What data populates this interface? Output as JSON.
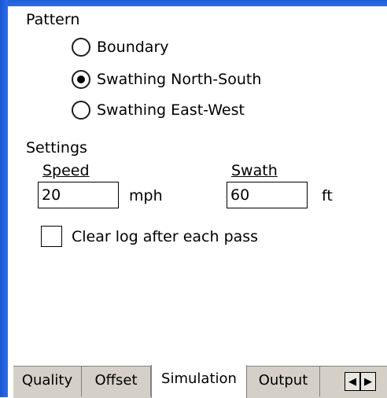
{
  "pattern": {
    "label": "Pattern",
    "options": [
      {
        "label": "Boundary",
        "checked": false
      },
      {
        "label": "Swathing North-South",
        "checked": true
      },
      {
        "label": "Swathing East-West",
        "checked": false
      }
    ]
  },
  "settings": {
    "label": "Settings",
    "speed": {
      "label": "Speed",
      "value": "20",
      "unit": "mph"
    },
    "swath": {
      "label": "Swath",
      "value": "60",
      "unit": "ft"
    },
    "clear_log": {
      "label": "Clear log after each pass",
      "checked": false
    }
  },
  "tabs": [
    {
      "label": "Quality",
      "active": false
    },
    {
      "label": "Offset",
      "active": false
    },
    {
      "label": "Simulation",
      "active": true
    },
    {
      "label": "Output",
      "active": false
    }
  ],
  "tab_scroll": {
    "left_icon": "arrow-left-icon",
    "right_icon": "arrow-right-icon"
  }
}
